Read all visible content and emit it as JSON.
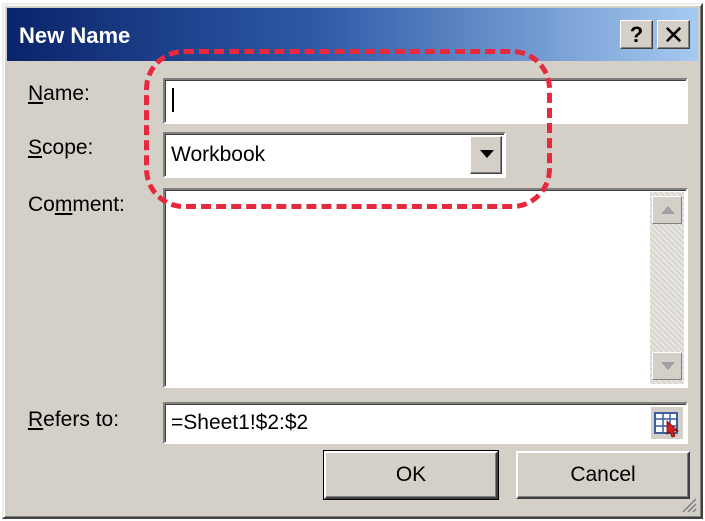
{
  "window": {
    "title": "New Name",
    "help_label": "?",
    "close_label": "✕"
  },
  "name_field": {
    "label_accel": "N",
    "label_rest": "ame:",
    "value": ""
  },
  "scope_field": {
    "label_accel": "S",
    "label_rest": "cope:",
    "value": "Workbook"
  },
  "comment_field": {
    "label_pre": "Co",
    "label_accel": "m",
    "label_rest": "ment:",
    "value": ""
  },
  "refers_field": {
    "label_accel": "R",
    "label_rest": "efers to:",
    "value": "=Sheet1!$2:$2"
  },
  "buttons": {
    "ok": "OK",
    "cancel": "Cancel"
  },
  "icons": [
    "help-icon",
    "close-icon",
    "dropdown-arrow-icon",
    "scroll-up-arrow-icon",
    "scroll-down-arrow-icon",
    "range-select-icon",
    "resize-grip-icon"
  ],
  "colors": {
    "titlebar_start": "#0a246a",
    "titlebar_end": "#a6caf0",
    "dialog_bg": "#d4d0c8",
    "highlight": "#e8283c"
  }
}
